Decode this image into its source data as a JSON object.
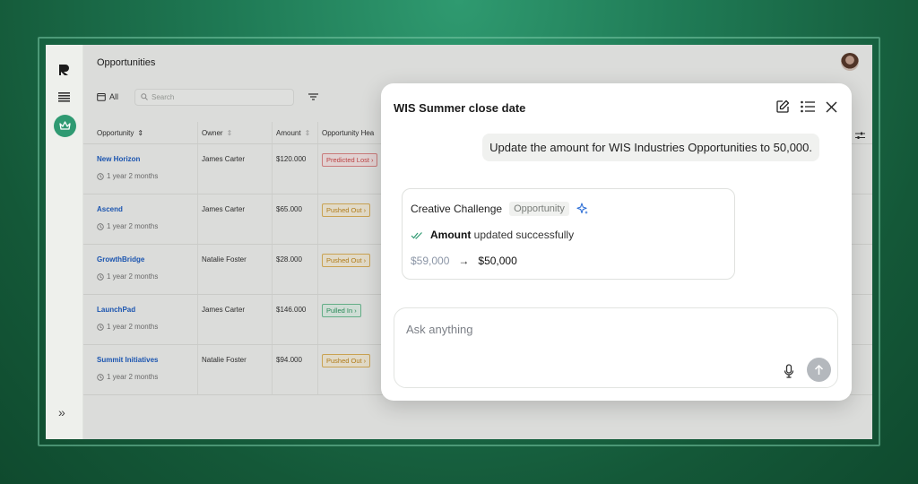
{
  "page": {
    "title": "Opportunities",
    "all_label": "All",
    "search_placeholder": "Search"
  },
  "table": {
    "columns": [
      "Opportunity",
      "Owner",
      "Amount",
      "Opportunity Hea"
    ],
    "rows": [
      {
        "name": "New Horizon",
        "time": "1 year 2 months",
        "owner": "James Carter",
        "amount": "$120.000",
        "status": "Predicted Lost",
        "status_kind": "red"
      },
      {
        "name": "Ascend",
        "time": "1 year 2 months",
        "owner": "James Carter",
        "amount": "$65.000",
        "status": "Pushed Out",
        "status_kind": "amber"
      },
      {
        "name": "GrowthBridge",
        "time": "1 year 2 months",
        "owner": "Natalie Foster",
        "amount": "$28.000",
        "status": "Pushed Out",
        "status_kind": "amber"
      },
      {
        "name": "LaunchPad",
        "time": "1 year 2 months",
        "owner": "James Carter",
        "amount": "$146.000",
        "status": "Pulled In",
        "status_kind": "green"
      },
      {
        "name": "Summit Initiatives",
        "time": "1 year 2 months",
        "owner": "Natalie Foster",
        "amount": "$94.000",
        "status": "Pushed Out",
        "status_kind": "amber"
      }
    ]
  },
  "chat": {
    "title": "WIS Summer close date",
    "user_message": "Update the amount for WIS Industries Opportunities to 50,000.",
    "card": {
      "name": "Creative Challenge",
      "tag": "Opportunity",
      "status_bold": "Amount",
      "status_rest": "updated successfully",
      "old_value": "$59,000",
      "arrow": "→",
      "new_value": "$50,000"
    },
    "input_placeholder": "Ask anything"
  },
  "colors": {
    "accent": "#2f9a72",
    "link": "#1f5fc4"
  }
}
